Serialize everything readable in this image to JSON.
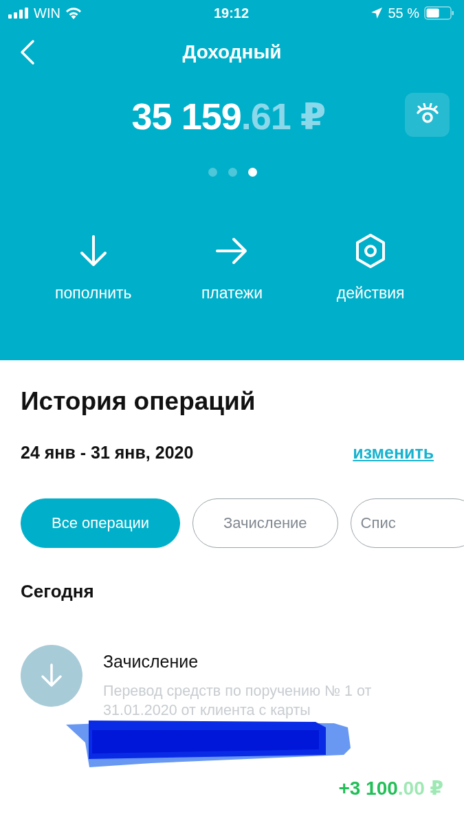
{
  "status_bar": {
    "carrier": "WIN",
    "time": "19:12",
    "battery_percent": "55 %",
    "battery": {
      "level": 0.55
    }
  },
  "header": {
    "title": "Доходный",
    "balance": {
      "whole": "35 159",
      "fraction": ".61 ₽"
    },
    "pager": [
      {
        "selected": false
      },
      {
        "selected": false
      },
      {
        "selected": true
      }
    ],
    "actions": [
      {
        "kind": "deposit",
        "label": "пополнить"
      },
      {
        "kind": "payments",
        "label": "платежи"
      },
      {
        "kind": "settings",
        "label": "действия"
      }
    ]
  },
  "history": {
    "title": "История операций",
    "period": "24 янв - 31 янв, 2020",
    "change_link": "изменить",
    "filters": [
      {
        "label": "Все операции",
        "selected": true
      },
      {
        "label": "Зачисление",
        "selected": false
      },
      {
        "label": "Спис",
        "selected": false
      }
    ],
    "groups": [
      {
        "title": "Сегодня",
        "operations": [
          {
            "title": "Зачисление",
            "description": "Перевод средств по поручению № 1 от 31.01.2020 от клиента с карты",
            "amount_whole": "+3 100",
            "amount_fraction": ".00 ₽"
          }
        ]
      }
    ]
  }
}
